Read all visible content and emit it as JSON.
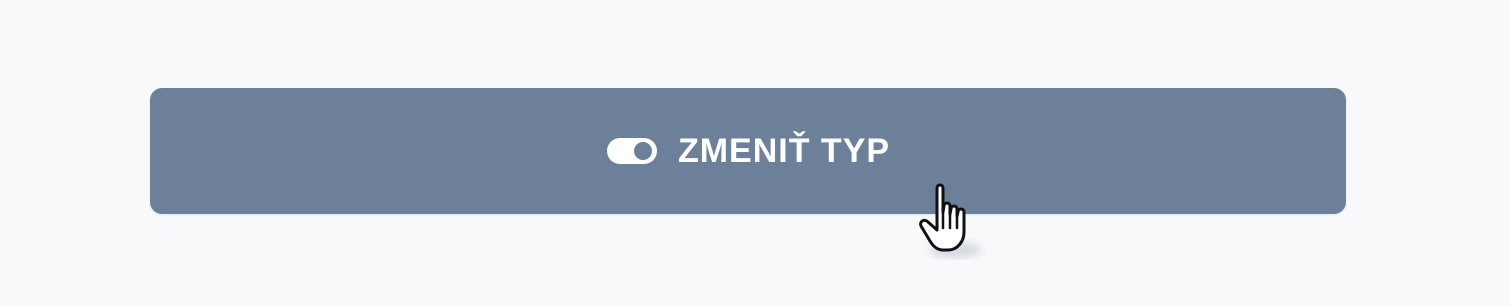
{
  "colors": {
    "background": "#f8f9fb",
    "button": "#6c8199",
    "text": "#ffffff"
  },
  "button": {
    "label": "ZMENIŤ TYP",
    "icon": "toggle-icon"
  },
  "cursor": {
    "icon": "hand-pointer-icon"
  }
}
